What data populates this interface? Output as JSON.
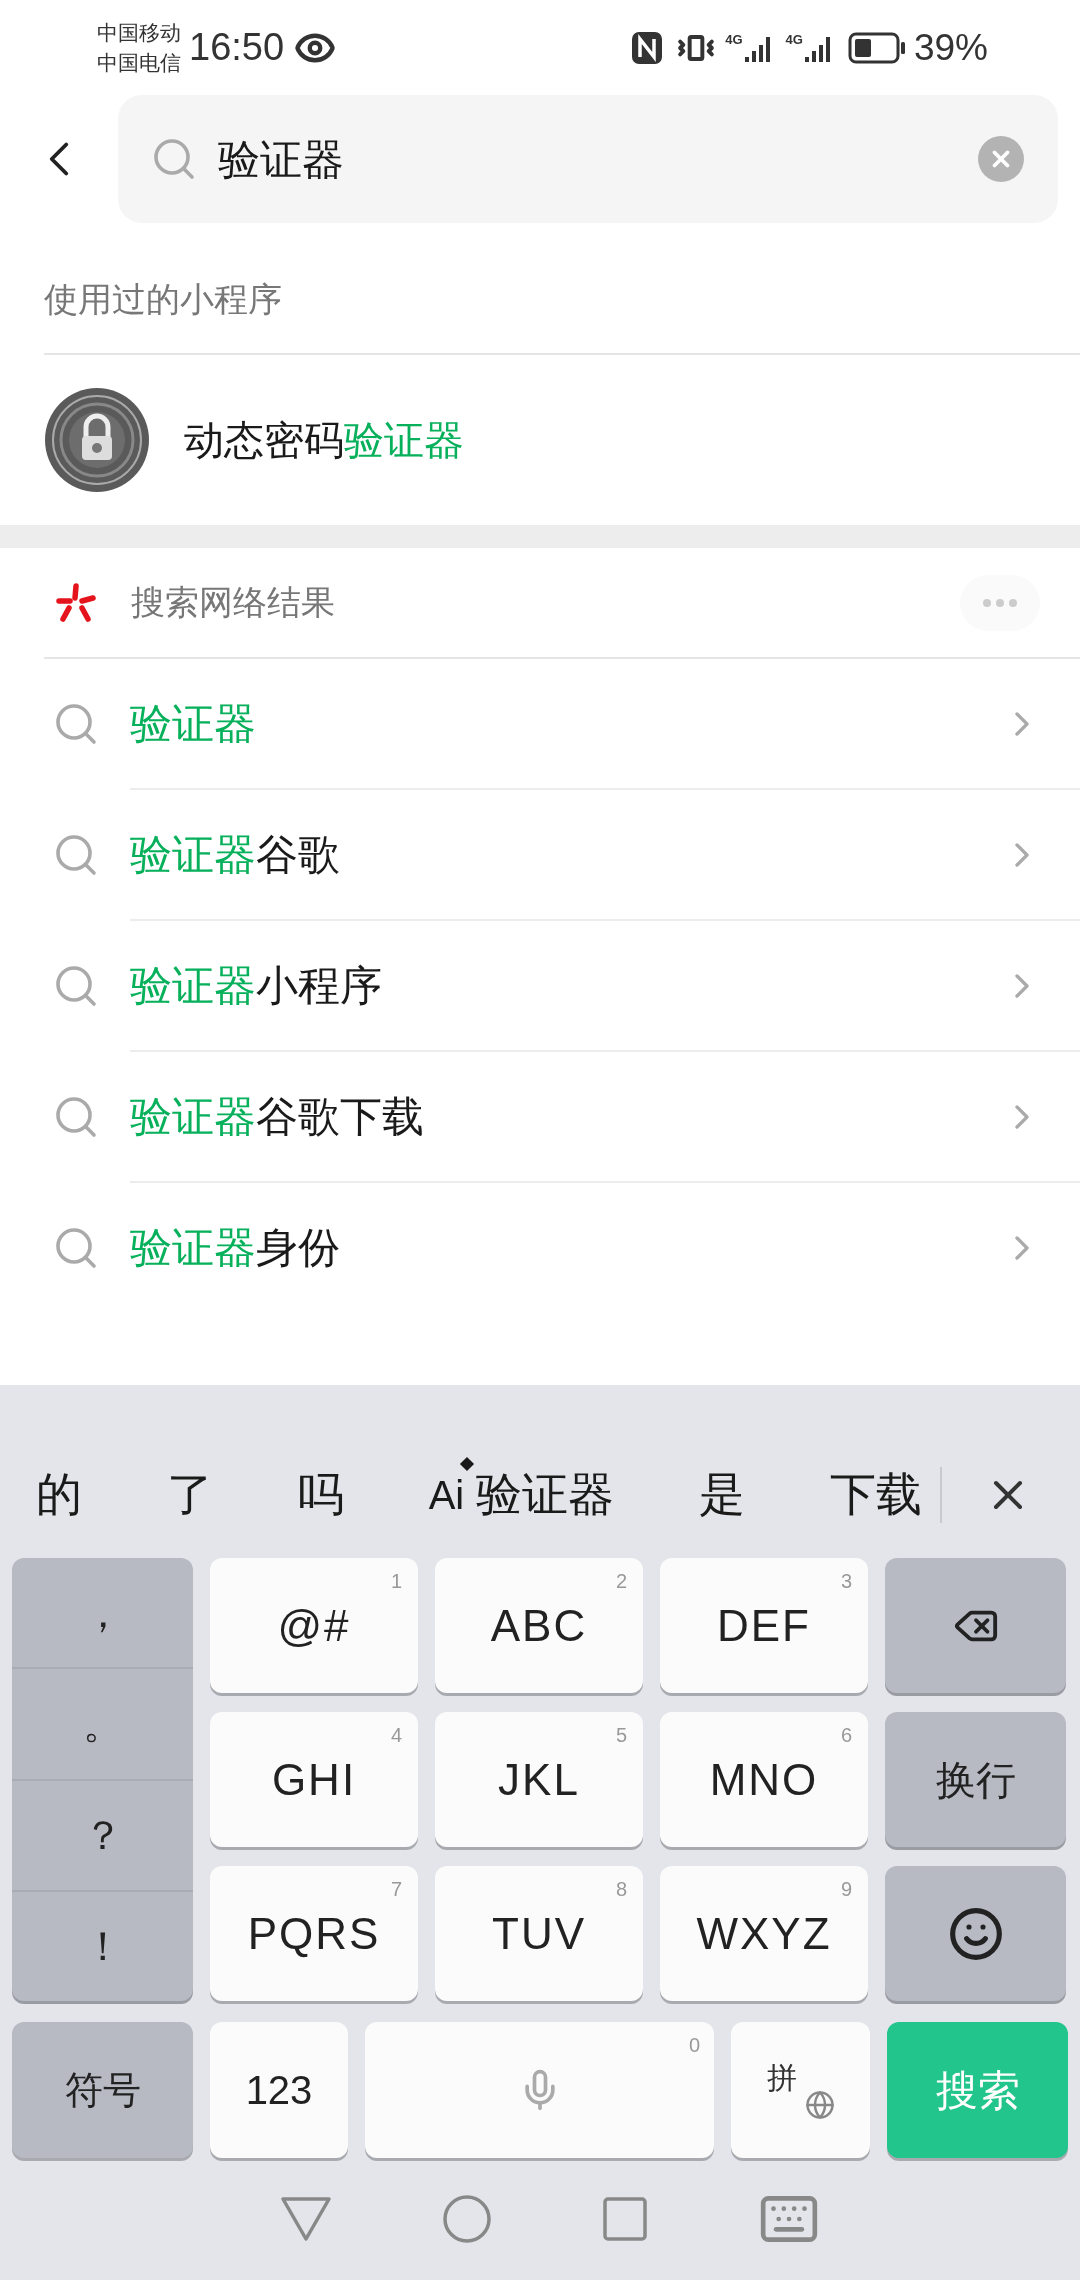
{
  "status_bar": {
    "carriers": [
      "中国移动",
      "中国电信"
    ],
    "time": "16:50",
    "networks": [
      "4G",
      "4G"
    ],
    "battery": "39%"
  },
  "search": {
    "value": "验证器"
  },
  "used_section": {
    "title": "使用过的小程序",
    "items": [
      {
        "segments": [
          {
            "text": "动态密码",
            "highlight": false
          },
          {
            "text": "验证器",
            "highlight": true
          }
        ]
      }
    ]
  },
  "web_section": {
    "title": "搜索网络结果",
    "suggestions": [
      {
        "segments": [
          {
            "text": "验证器",
            "highlight": true
          }
        ]
      },
      {
        "segments": [
          {
            "text": "验证器",
            "highlight": true
          },
          {
            "text": "谷歌",
            "highlight": false
          }
        ]
      },
      {
        "segments": [
          {
            "text": "验证器",
            "highlight": true
          },
          {
            "text": "小程序",
            "highlight": false
          }
        ]
      },
      {
        "segments": [
          {
            "text": "验证器",
            "highlight": true
          },
          {
            "text": "谷歌下载",
            "highlight": false
          }
        ]
      },
      {
        "segments": [
          {
            "text": "验证器",
            "highlight": true
          },
          {
            "text": "身份",
            "highlight": false
          }
        ]
      }
    ]
  },
  "keyboard": {
    "candidates": [
      {
        "text": "的"
      },
      {
        "text": "了"
      },
      {
        "text": "吗"
      },
      {
        "text": "验证器",
        "badge": "Ai"
      },
      {
        "text": "是"
      },
      {
        "text": "下载"
      }
    ],
    "punctuation": [
      "，",
      "。",
      "？",
      "！"
    ],
    "keys": [
      {
        "label": "@#",
        "number": "1"
      },
      {
        "label": "ABC",
        "number": "2"
      },
      {
        "label": "DEF",
        "number": "3"
      },
      {
        "label": "GHI",
        "number": "4"
      },
      {
        "label": "JKL",
        "number": "5"
      },
      {
        "label": "MNO",
        "number": "6"
      },
      {
        "label": "PQRS",
        "number": "7"
      },
      {
        "label": "TUV",
        "number": "8"
      },
      {
        "label": "WXYZ",
        "number": "9"
      }
    ],
    "side_keys": [
      {
        "kind": "backspace"
      },
      {
        "kind": "text",
        "label": "换行"
      },
      {
        "kind": "emoji"
      }
    ],
    "bottom_keys": [
      {
        "kind": "text",
        "label": "符号"
      },
      {
        "kind": "plain",
        "label": "123"
      },
      {
        "kind": "space",
        "number": "0"
      },
      {
        "kind": "pinyin",
        "label": "拼"
      },
      {
        "kind": "primary",
        "label": "搜索"
      }
    ]
  }
}
